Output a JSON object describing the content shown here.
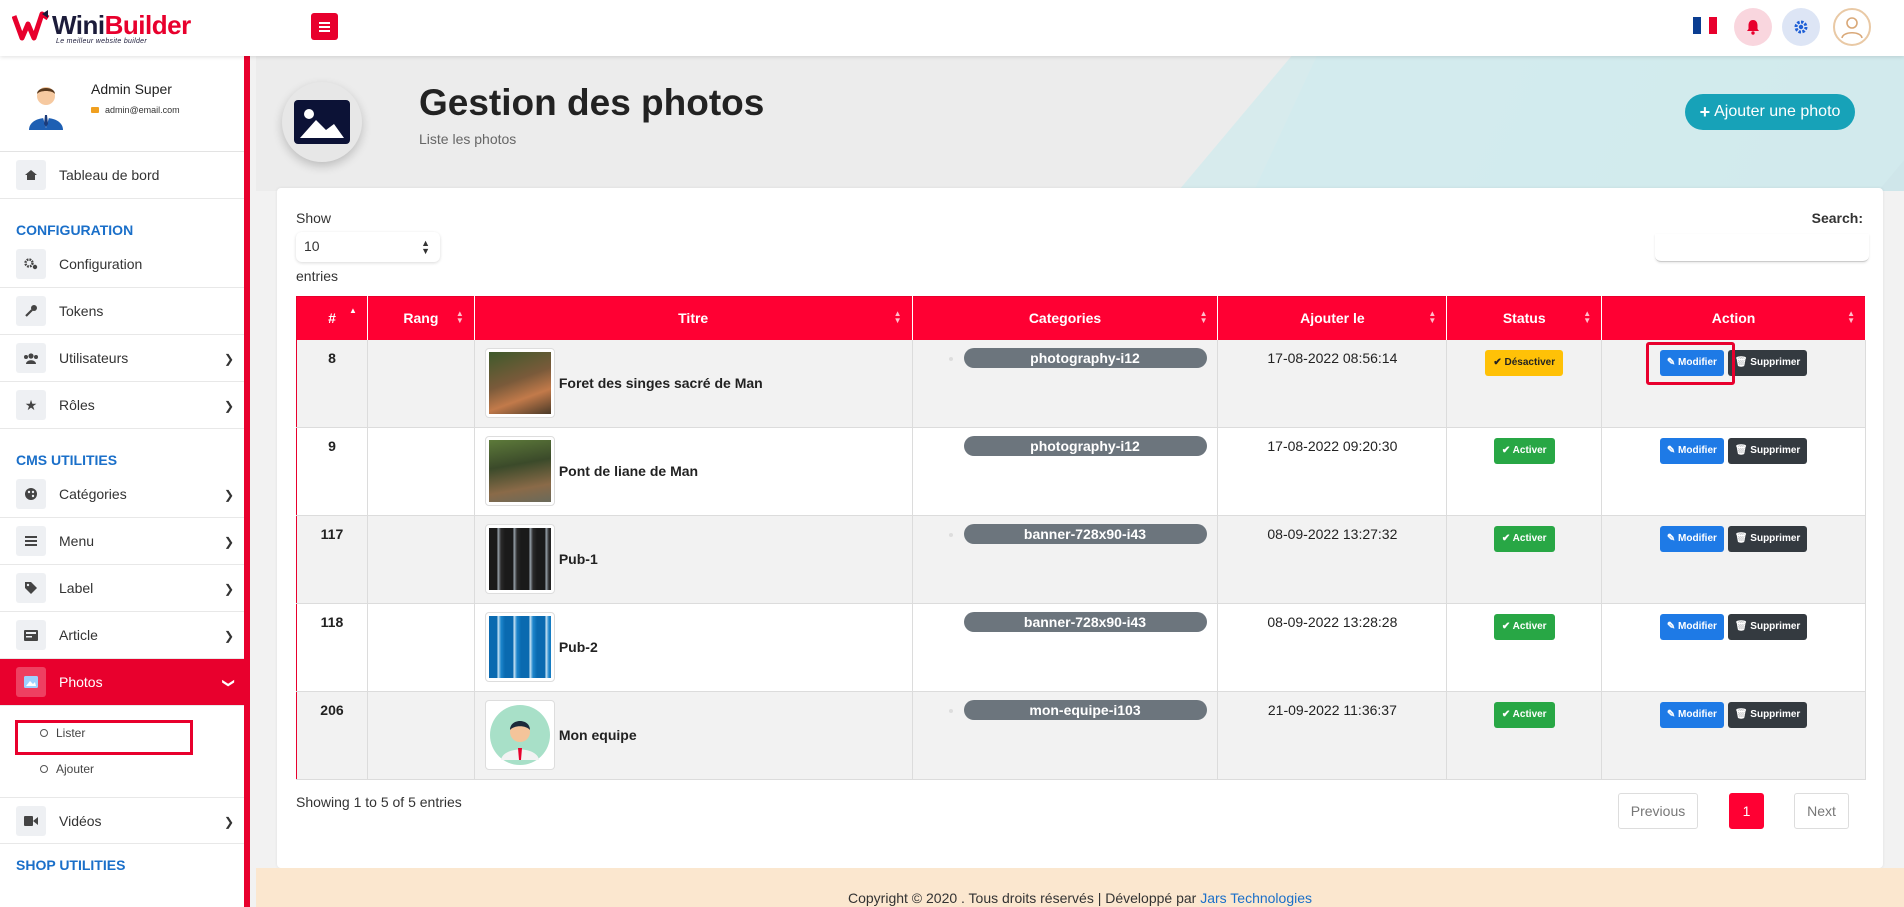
{
  "brand": {
    "name_a": "Wini",
    "name_b": "Builder",
    "tagline": "Le meilleur website builder"
  },
  "header": {
    "language_icon": "flag-fr-icon",
    "icons": [
      "bell-icon",
      "gear-icon",
      "user-avatar-icon"
    ]
  },
  "profile": {
    "name": "Admin Super",
    "email": "admin@email.com"
  },
  "sidebar": {
    "dashboard": "Tableau de bord",
    "section_config": "CONFIGURATION",
    "configuration": "Configuration",
    "tokens": "Tokens",
    "utilisateurs": "Utilisateurs",
    "roles": "Rôles",
    "section_cms": "CMS UTILITIES",
    "categories": "Catégories",
    "menu": "Menu",
    "label": "Label",
    "article": "Article",
    "photos": "Photos",
    "lister": "Lister",
    "ajouter": "Ajouter",
    "videos": "Vidéos",
    "section_shop": "SHOP UTILITIES"
  },
  "page": {
    "title": "Gestion des photos",
    "subtitle": "Liste les photos",
    "add_button": "Ajouter une photo"
  },
  "table_controls": {
    "show": "Show",
    "length": "10",
    "entries": "entries",
    "search": "Search:"
  },
  "columns": [
    "#",
    "Rang",
    "Titre",
    "Categories",
    "Ajouter le",
    "Status",
    "Action"
  ],
  "rows": [
    {
      "id": "8",
      "rang": "",
      "titre": "Foret des singes sacré de Man",
      "categorie": "photography-i12",
      "date": "17-08-2022 08:56:14",
      "status": "Désactiver",
      "status_on": false
    },
    {
      "id": "9",
      "rang": "",
      "titre": "Pont de liane de Man",
      "categorie": "photography-i12",
      "date": "17-08-2022 09:20:30",
      "status": "Activer",
      "status_on": true
    },
    {
      "id": "117",
      "rang": "",
      "titre": "Pub-1",
      "categorie": "banner-728x90-i43",
      "date": "08-09-2022 13:27:32",
      "status": "Activer",
      "status_on": true
    },
    {
      "id": "118",
      "rang": "",
      "titre": "Pub-2",
      "categorie": "banner-728x90-i43",
      "date": "08-09-2022 13:28:28",
      "status": "Activer",
      "status_on": true
    },
    {
      "id": "206",
      "rang": "",
      "titre": "Mon equipe",
      "categorie": "mon-equipe-i103",
      "date": "21-09-2022 11:36:37",
      "status": "Activer",
      "status_on": true
    }
  ],
  "actions": {
    "edit": "Modifier",
    "delete": "Supprimer"
  },
  "footer_info": {
    "showing": "Showing 1 to 5 of 5 entries",
    "previous": "Previous",
    "page": "1",
    "next": "Next"
  },
  "footer": {
    "text": "Copyright © 2020 . Tous droits réservés | Développé par ",
    "link": "Jars Technologies"
  },
  "colors": {
    "primary": "#e8002d",
    "info": "#17a2b8",
    "edit": "#1e7ae6",
    "delete": "#343a40",
    "success": "#28a745",
    "warning": "#ffc107",
    "section": "#1a6fc9"
  }
}
